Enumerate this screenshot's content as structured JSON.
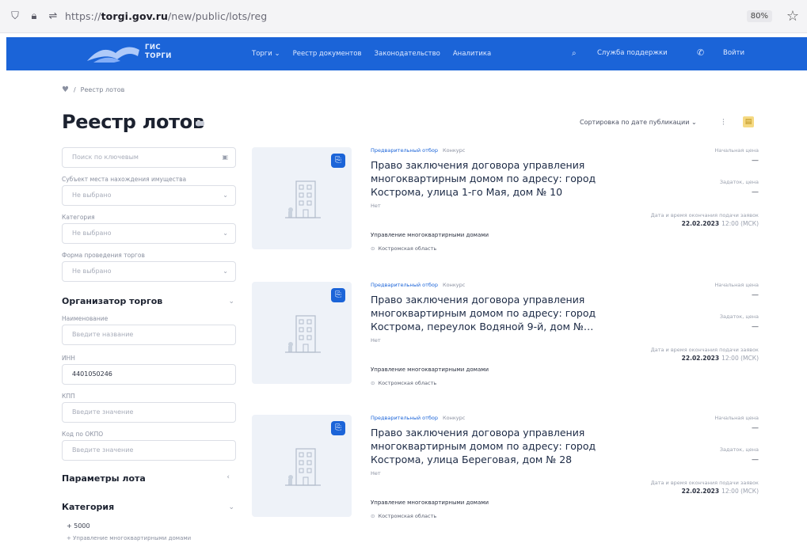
{
  "browser": {
    "url_prefix": "https://",
    "url_domain": "torgi.gov.ru",
    "url_path": "/new/public/lots/reg",
    "zoom": "80%"
  },
  "header": {
    "logo_line1": "ГИС",
    "logo_line2": "ТОРГИ",
    "nav": [
      "Торги ⌄",
      "Реестр документов",
      "Законодательство",
      "Аналитика"
    ],
    "support": "Служба поддержки",
    "login": "Войти"
  },
  "breadcrumb": {
    "current": "Реестр лотов"
  },
  "page": {
    "title": "Реестр лотов",
    "sort_label": "Сортировка по дате публикации ⌄"
  },
  "sidebar": {
    "search_placeholder": "Поиск по ключевым",
    "labels": [
      "Субъект места нахождения имущества",
      "Категория",
      "Форма проведения торгов"
    ],
    "not_selected": "Не выбрано",
    "organizer_title": "Организатор торгов",
    "org_name_label": "Наименование",
    "org_name_placeholder": "Введите название",
    "inn_label": "ИНН",
    "inn_value": "4401050246",
    "kpp_label": "КПП",
    "kpp_placeholder": "Введите значение",
    "code_label": "Код по ОКПО",
    "code_placeholder": "Введите значение",
    "lot_params_title": "Параметры лота",
    "categories_title": "Категория",
    "category_item": "5000",
    "category_sub": "Управление многоквартирными домами"
  },
  "cards": [
    {
      "tag": "Предварительный отбор",
      "tag_alt": "Конкурс",
      "title": "Право заключения договора управления многоквартирным домом по адресу: город Кострома, улица 1-го Мая, дом № 10",
      "sub": "Нет",
      "kind": "Управление многоквартирными домами",
      "region": "Костромская область",
      "price_label": "Начальная цена",
      "price_value": "—",
      "deposit_label": "Задаток, цена",
      "deposit_value": "—",
      "deadline_label": "Дата и время окончания подачи заявок",
      "deadline_date": "22.02.2023",
      "deadline_time": "12:00 (МСК)"
    },
    {
      "tag": "Предварительный отбор",
      "tag_alt": "Конкурс",
      "title": "Право заключения договора управления многоквартирным домом по адресу: город Кострома, переулок Водяной 9-й, дом №…",
      "sub": "Нет",
      "kind": "Управление многоквартирными домами",
      "region": "Костромская область",
      "price_label": "Начальная цена",
      "price_value": "—",
      "deposit_label": "Задаток, цена",
      "deposit_value": "—",
      "deadline_label": "Дата и время окончания подачи заявок",
      "deadline_date": "22.02.2023",
      "deadline_time": "12:00 (МСК)"
    },
    {
      "tag": "Предварительный отбор",
      "tag_alt": "Конкурс",
      "title": "Право заключения договора управления многоквартирным домом по адресу: город Кострома, улица Береговая, дом № 28",
      "sub": "Нет",
      "kind": "Управление многоквартирными домами",
      "region": "Костромская область",
      "price_label": "Начальная цена",
      "price_value": "—",
      "deposit_label": "Задаток, цена",
      "deposit_value": "—",
      "deadline_label": "Дата и время окончания подачи заявок",
      "deadline_date": "22.02.2023",
      "deadline_time": "12:00 (МСК)"
    }
  ]
}
